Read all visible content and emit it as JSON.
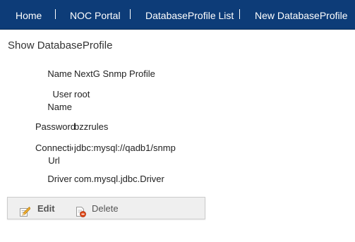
{
  "nav": {
    "items": [
      {
        "label": "Home"
      },
      {
        "label": "NOC Portal"
      },
      {
        "label": "DatabaseProfile List"
      },
      {
        "label": "New DatabaseProfile"
      }
    ]
  },
  "page": {
    "title": "Show DatabaseProfile"
  },
  "properties": {
    "name": {
      "label": "Name",
      "value": "NextG Snmp Profile"
    },
    "user_name": {
      "label": "User Name",
      "value": "root"
    },
    "password": {
      "label": "Password",
      "value": "bzzrules"
    },
    "connection_url": {
      "label": "Connection Url",
      "value": "jdbc:mysql://qadb1/snmp"
    },
    "driver": {
      "label": "Driver",
      "value": "com.mysql.jdbc.Driver"
    }
  },
  "buttons": {
    "edit_label": "Edit",
    "delete_label": "Delete"
  },
  "colors": {
    "nav_background": "#0d3c78",
    "nav_text": "#ffffff",
    "button_bar_background": "#efefef"
  }
}
